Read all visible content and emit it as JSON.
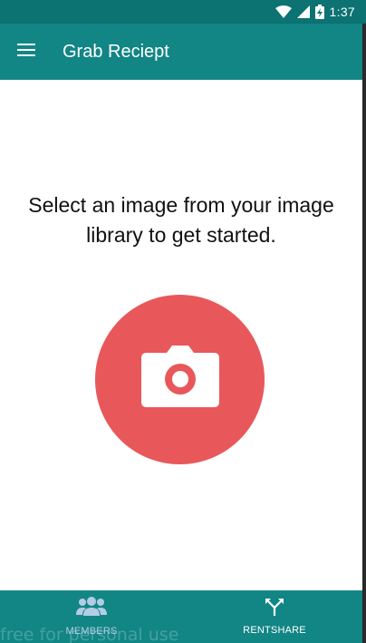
{
  "status_bar": {
    "time": "1:37",
    "icons": [
      "wifi-icon",
      "cell-signal-icon",
      "battery-charging-icon"
    ]
  },
  "app_bar": {
    "title": "Grab Reciept",
    "menu_icon": "hamburger-menu-icon"
  },
  "main": {
    "prompt": "Select an image from your image library to get started.",
    "camera_icon": "camera-icon",
    "accent_color": "#e8585a"
  },
  "bottom_nav": {
    "items": [
      {
        "label": "MEMBERS",
        "icon": "group-icon",
        "active": true
      },
      {
        "label": "RENTSHARE",
        "icon": "call-split-icon",
        "active": false
      }
    ]
  },
  "watermark": "free for personal use",
  "colors": {
    "primary": "#128585",
    "primary_dark": "#0c7272",
    "active_nav": "#b3cde6"
  }
}
